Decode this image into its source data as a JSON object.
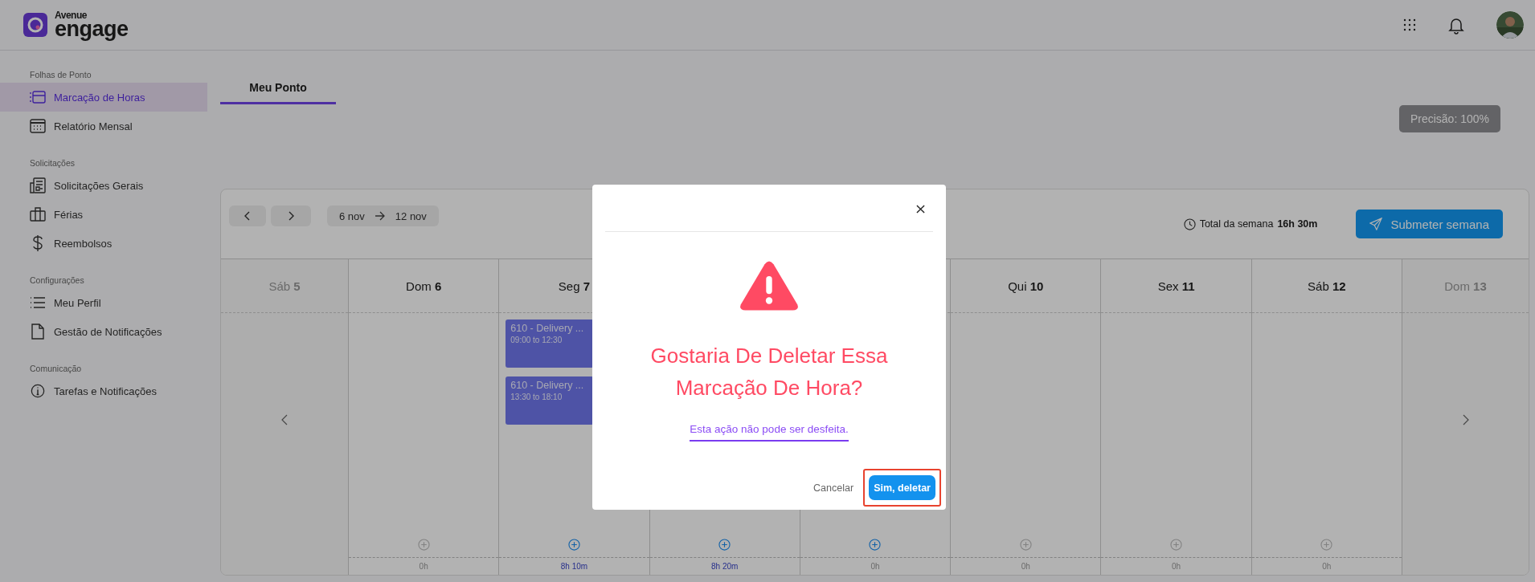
{
  "header": {
    "logo": {
      "top": "Avenue",
      "bottom": "engage"
    }
  },
  "sidebar": {
    "sections": [
      {
        "label": "Folhas de Ponto",
        "items": [
          {
            "label": "Marcação de Horas",
            "selected": true
          },
          {
            "label": "Relatório Mensal",
            "selected": false
          }
        ]
      },
      {
        "label": "Solicitações",
        "items": [
          {
            "label": "Solicitações Gerais",
            "selected": false
          },
          {
            "label": "Férias",
            "selected": false
          },
          {
            "label": "Reembolsos",
            "selected": false
          }
        ]
      },
      {
        "label": "Configurações",
        "items": [
          {
            "label": "Meu Perfil",
            "selected": false
          },
          {
            "label": "Gestão de Notificações",
            "selected": false
          }
        ]
      },
      {
        "label": "Comunicação",
        "items": [
          {
            "label": "Tarefas e Notificações",
            "selected": false
          }
        ]
      }
    ]
  },
  "tabs": [
    {
      "label": "Meu Ponto",
      "selected": true
    }
  ],
  "precision_badge": "Precisão: 100%",
  "week_bar": {
    "range_start": "6 nov",
    "range_end": "12 nov",
    "total_label": "Total da semana",
    "total_value": "16h 30m",
    "submit": "Submeter semana"
  },
  "days": [
    {
      "weekday": "Sáb",
      "day": "5",
      "in_week": false
    },
    {
      "weekday": "Dom",
      "day": "6",
      "in_week": true,
      "total": "0h",
      "has_hours": false,
      "add_enabled": false
    },
    {
      "weekday": "Seg",
      "day": "7",
      "in_week": true,
      "total": "8h 10m",
      "has_hours": true,
      "add_enabled": true,
      "events": [
        {
          "title": "610 - Delivery ...",
          "time": "09:00 to 12:30"
        },
        {
          "title": "610 - Delivery ...",
          "time": "13:30 to 18:10"
        }
      ]
    },
    {
      "in_week": true,
      "total": "8h 20m",
      "has_hours": true,
      "add_enabled": true
    },
    {
      "in_week": true,
      "total": "0h",
      "has_hours": false,
      "add_enabled": true
    },
    {
      "weekday": "Qui",
      "day": "10",
      "in_week": true,
      "total": "0h",
      "has_hours": false,
      "add_enabled": false
    },
    {
      "weekday": "Sex",
      "day": "11",
      "in_week": true,
      "total": "0h",
      "has_hours": false,
      "add_enabled": false
    },
    {
      "weekday": "Sáb",
      "day": "12",
      "in_week": true,
      "total": "0h",
      "has_hours": false,
      "add_enabled": false
    },
    {
      "weekday": "Dom",
      "day": "13",
      "in_week": false
    }
  ],
  "dialog": {
    "title": "Gostaria De Deletar Essa Marcação De Hora?",
    "message": "Esta ação não pode ser desfeita.",
    "cancel": "Cancelar",
    "confirm": "Sim, deletar",
    "confirm_highlighted": true
  }
}
